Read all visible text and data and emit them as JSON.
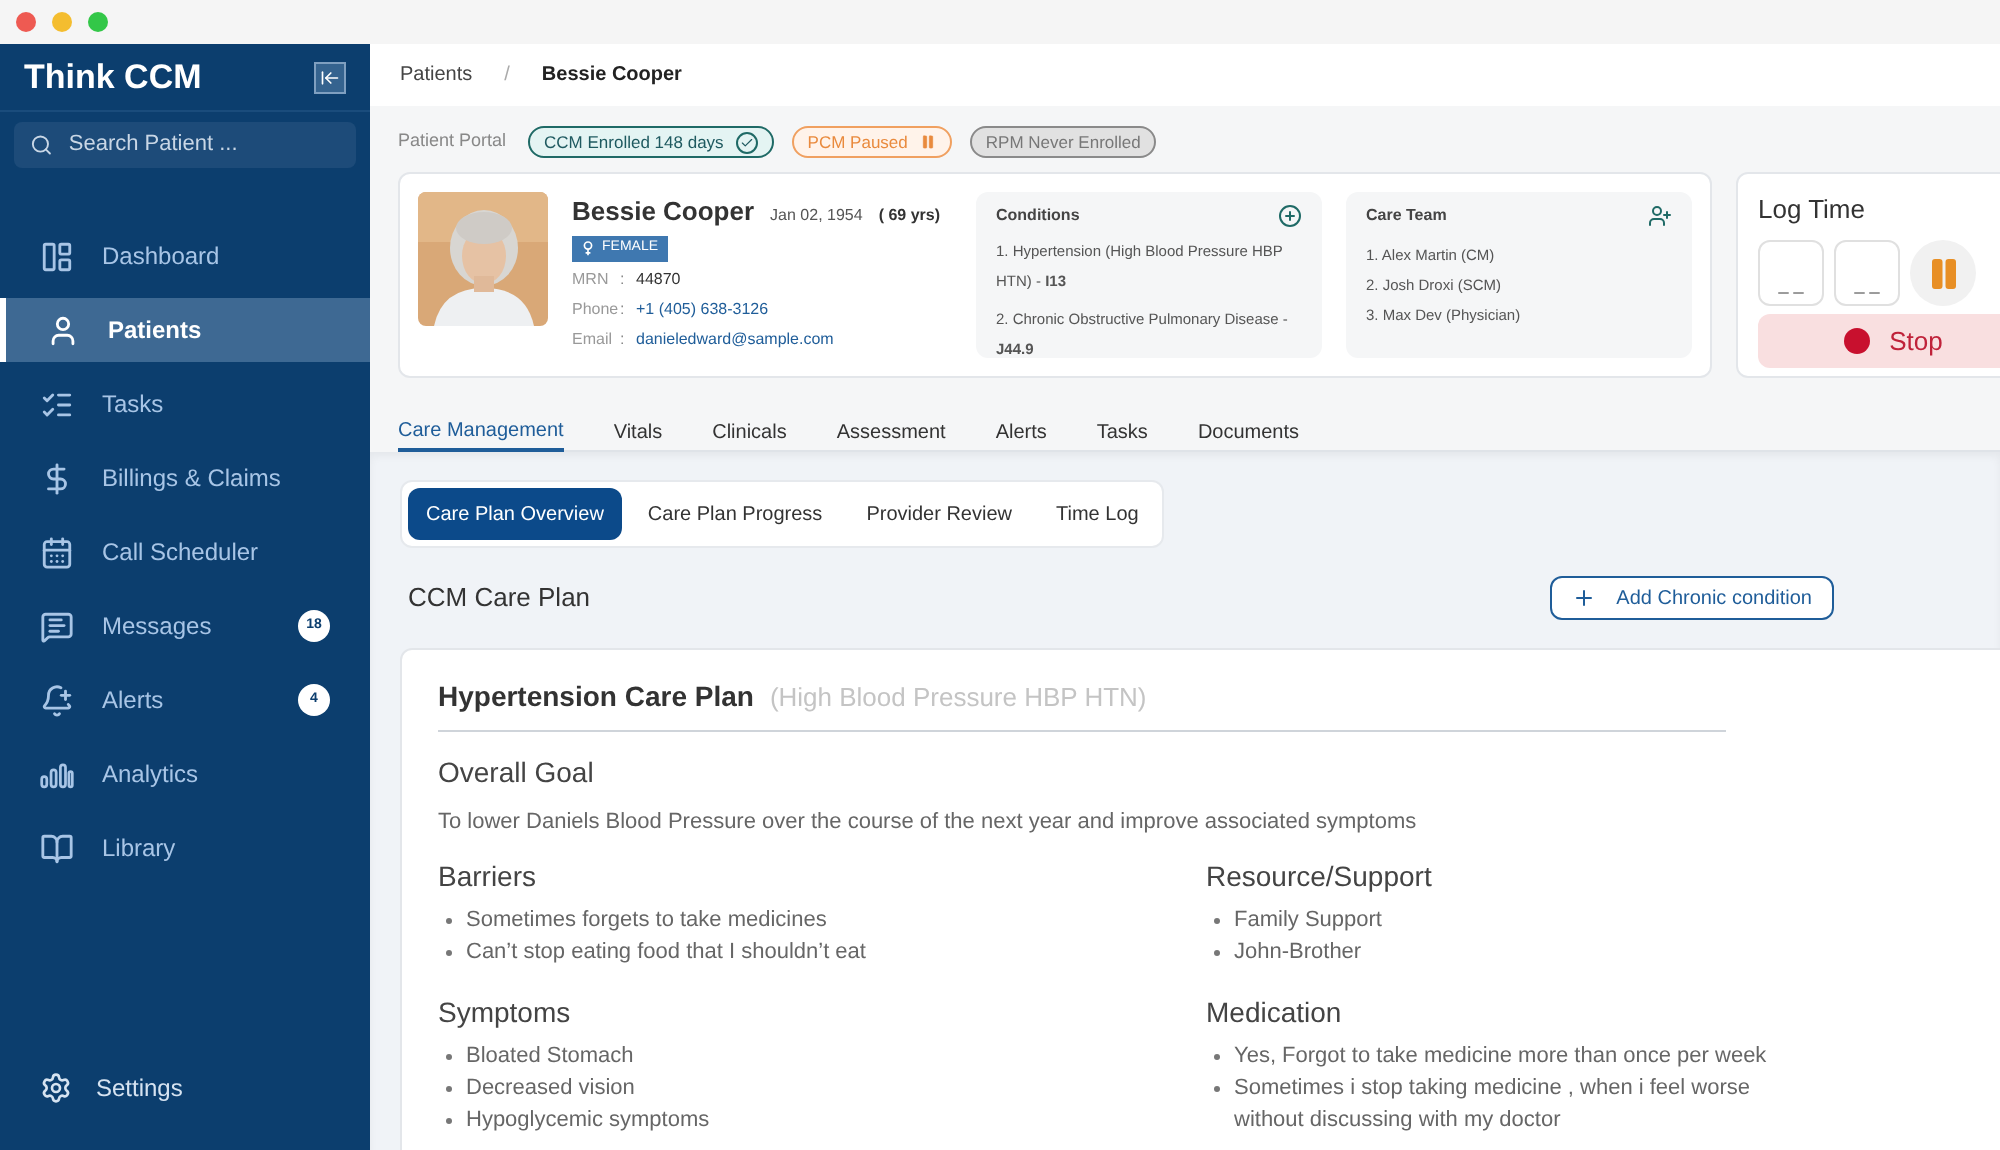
{
  "sidebar": {
    "brand": "Think CCM",
    "search": {
      "placeholder": "Search Patient ..."
    },
    "items": [
      {
        "label": "Dashboard",
        "selected": false
      },
      {
        "label": "Patients",
        "selected": true
      },
      {
        "label": "Tasks",
        "selected": false
      },
      {
        "label": "Billings & Claims",
        "selected": false
      },
      {
        "label": "Call Scheduler",
        "selected": false
      },
      {
        "label": "Messages",
        "selected": false,
        "badge": "18"
      },
      {
        "label": "Alerts",
        "selected": false,
        "badge": "4"
      },
      {
        "label": "Analytics",
        "selected": false
      },
      {
        "label": "Library",
        "selected": false
      }
    ],
    "settings": "Settings"
  },
  "breadcrumb": {
    "separator": "/",
    "items": [
      "Patients",
      "Bessie Cooper"
    ]
  },
  "portal": {
    "label": "Patient Portal",
    "programs": [
      {
        "label": "CCM Enrolled 148 days",
        "kind": "enrolled"
      },
      {
        "label": "PCM Paused",
        "kind": "paused"
      },
      {
        "label": "RPM Never Enrolled",
        "kind": "never"
      }
    ]
  },
  "patient": {
    "name": "Bessie Cooper",
    "dob": "Jan 02, 1954",
    "age": "( 69 yrs)",
    "gender": "FEMALE",
    "separator": ":",
    "fields": [
      {
        "label": "MRN",
        "value": "44870",
        "kind": "text"
      },
      {
        "label": "Phone",
        "value": "+1 (405) 638-3126",
        "kind": "link"
      },
      {
        "label": "Email",
        "value": "danieledward@sample.com",
        "kind": "link"
      }
    ]
  },
  "conditions": {
    "title": "Conditions",
    "items": [
      "1. Hypertension (High Blood Pressure HBP HTN) - **I13**",
      "2. Chronic Obstructive Pulmonary Disease - **J44.9**"
    ]
  },
  "care_team": {
    "title": "Care Team",
    "members": [
      "1. Alex Martin (CM)",
      "2. Josh Droxi (SCM)",
      "3. Max Dev (Physician)"
    ]
  },
  "log_time": {
    "title": "Log Time",
    "fields": [
      "_ _",
      "_ _"
    ],
    "stop": "Stop"
  },
  "tabs": [
    {
      "label": "Care Management",
      "selected": true
    },
    {
      "label": "Vitals",
      "selected": false
    },
    {
      "label": "Clinicals",
      "selected": false
    },
    {
      "label": "Assessment",
      "selected": false
    },
    {
      "label": "Alerts",
      "selected": false
    },
    {
      "label": "Tasks",
      "selected": false
    },
    {
      "label": "Documents",
      "selected": false
    }
  ],
  "subtabs": [
    {
      "label": "Care Plan Overview",
      "selected": true
    },
    {
      "label": "Care Plan Progress",
      "selected": false
    },
    {
      "label": "Provider Review",
      "selected": false
    },
    {
      "label": "Time Log",
      "selected": false
    }
  ],
  "care_plan": {
    "title": "CCM Care Plan",
    "add_button": "Add Chronic condition",
    "card": {
      "title": "Hypertension Care Plan",
      "subtitle": "(High Blood Pressure HBP HTN)",
      "goal": {
        "heading": "Overall Goal",
        "text": "To lower Daniels Blood Pressure over the course of the next year and improve associated symptoms"
      },
      "sections": [
        {
          "heading": "Barriers",
          "items": [
            "Sometimes forgets to take medicines",
            "Can’t stop eating food that I shouldn’t eat"
          ]
        },
        {
          "heading": "Resource/Support",
          "items": [
            "Family Support",
            "John-Brother"
          ]
        },
        {
          "heading": "Symptoms",
          "items": [
            "Bloated Stomach",
            "Decreased vision",
            "Hypoglycemic symptoms"
          ]
        },
        {
          "heading": "Medication",
          "items": [
            "Yes, Forgot to take medicine more than once per week",
            "Sometimes i stop taking medicine , when i feel worse without discussing with my doctor"
          ]
        }
      ]
    }
  }
}
